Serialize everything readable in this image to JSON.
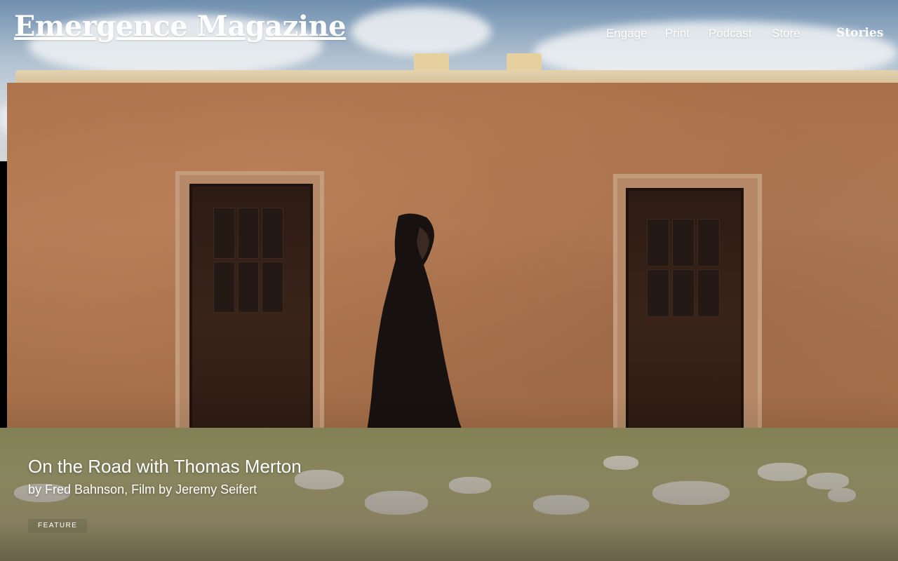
{
  "site": {
    "logo_text": "Emergence Magazine"
  },
  "nav": {
    "items": [
      {
        "label": "Engage"
      },
      {
        "label": "Print"
      },
      {
        "label": "Podcast"
      },
      {
        "label": "Store"
      }
    ],
    "stories_label": "Stories"
  },
  "feature": {
    "title": "On the Road with Thomas Merton",
    "byline": "by Fred Bahnson, Film by Jeremy Seifert",
    "tag": "FEATURE"
  },
  "hero_image": {
    "subject": "hooded figure in dark robe walking past an adobe building with two wooden doors"
  },
  "colors": {
    "text": "#ffffff",
    "adobe_wall": "#a8704a",
    "door": "#2c1b14",
    "sky": "#aebfcf"
  }
}
